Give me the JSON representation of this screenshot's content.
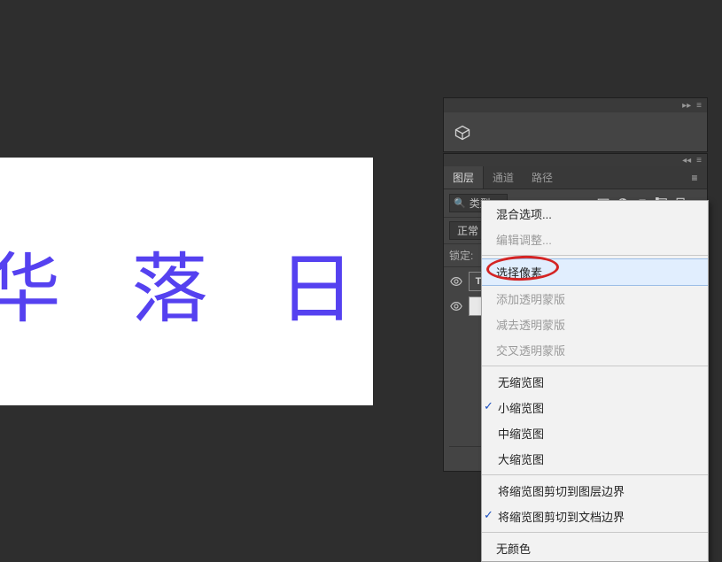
{
  "canvas": {
    "text": "华 落 日"
  },
  "panel": {
    "tabs": [
      {
        "label": "图层",
        "active": true
      },
      {
        "label": "通道",
        "active": false
      },
      {
        "label": "路径",
        "active": false
      }
    ],
    "filter_label": "类型",
    "mode": "正常",
    "lock_label": "锁定:"
  },
  "context_menu": {
    "group1": [
      "混合选项...",
      "编辑调整..."
    ],
    "highlight": "选择像素",
    "group2": [
      "添加透明蒙版",
      "减去透明蒙版",
      "交叉透明蒙版"
    ],
    "group3": [
      "无缩览图",
      "小缩览图",
      "中缩览图",
      "大缩览图"
    ],
    "group3_checked_index": 1,
    "group4": [
      "将缩览图剪切到图层边界",
      "将缩览图剪切到文档边界"
    ],
    "group4_checked_index": 1,
    "group5": [
      "无颜色"
    ]
  }
}
